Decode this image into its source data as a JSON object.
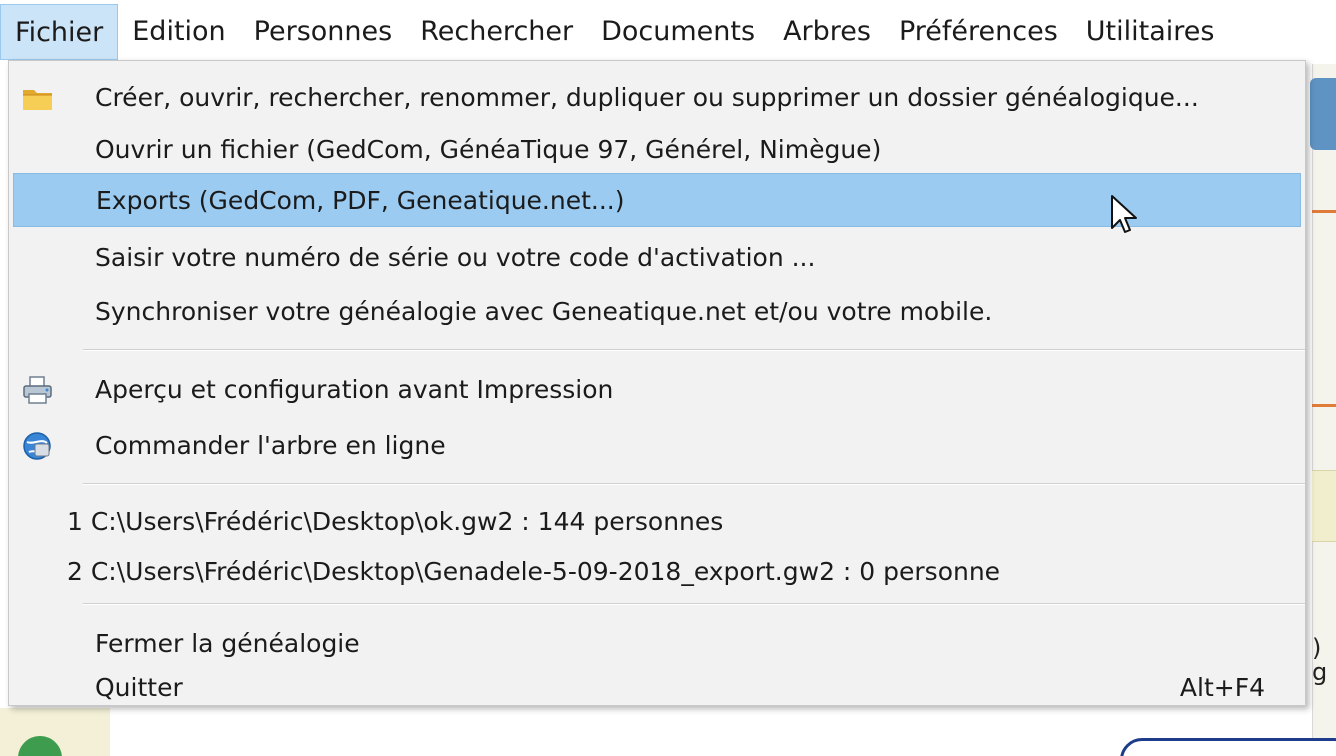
{
  "menubar": {
    "items": [
      {
        "label": "Fichier",
        "active": true
      },
      {
        "label": "Edition"
      },
      {
        "label": "Personnes"
      },
      {
        "label": "Rechercher"
      },
      {
        "label": "Documents"
      },
      {
        "label": "Arbres"
      },
      {
        "label": "Préférences"
      },
      {
        "label": "Utilitaires"
      }
    ]
  },
  "file_menu": {
    "items": [
      {
        "label": "Créer, ouvrir, rechercher, renommer, dupliquer ou supprimer un dossier généalogique...",
        "icon": "folder-icon"
      },
      {
        "label": "Ouvrir un fichier (GedCom, GénéaTique 97, Générel, Nimègue)"
      },
      {
        "label": "Exports (GedCom, PDF, Geneatique.net...)",
        "highlighted": true
      },
      {
        "label": "Saisir votre numéro de série ou votre code d'activation ..."
      },
      {
        "label": "Synchroniser votre généalogie avec Geneatique.net et/ou votre mobile."
      },
      {
        "label": "Aperçu et configuration avant Impression",
        "icon": "printer-icon"
      },
      {
        "label": "Commander l'arbre en ligne",
        "icon": "globe-icon"
      },
      {
        "label": "1 C:\\Users\\Frédéric\\Desktop\\ok.gw2 : 144 personnes"
      },
      {
        "label": "2 C:\\Users\\Frédéric\\Desktop\\Genadele-5-09-2018_export.gw2 : 0 personne"
      },
      {
        "label": "Fermer la généalogie"
      },
      {
        "label": "Quitter",
        "shortcut": "Alt+F4"
      }
    ]
  },
  "background": {
    "partial_text": "g"
  },
  "colors": {
    "menu_bg": "#f2f2f2",
    "highlight": "#9bcbf1",
    "active_menubar": "#cce4f7"
  }
}
